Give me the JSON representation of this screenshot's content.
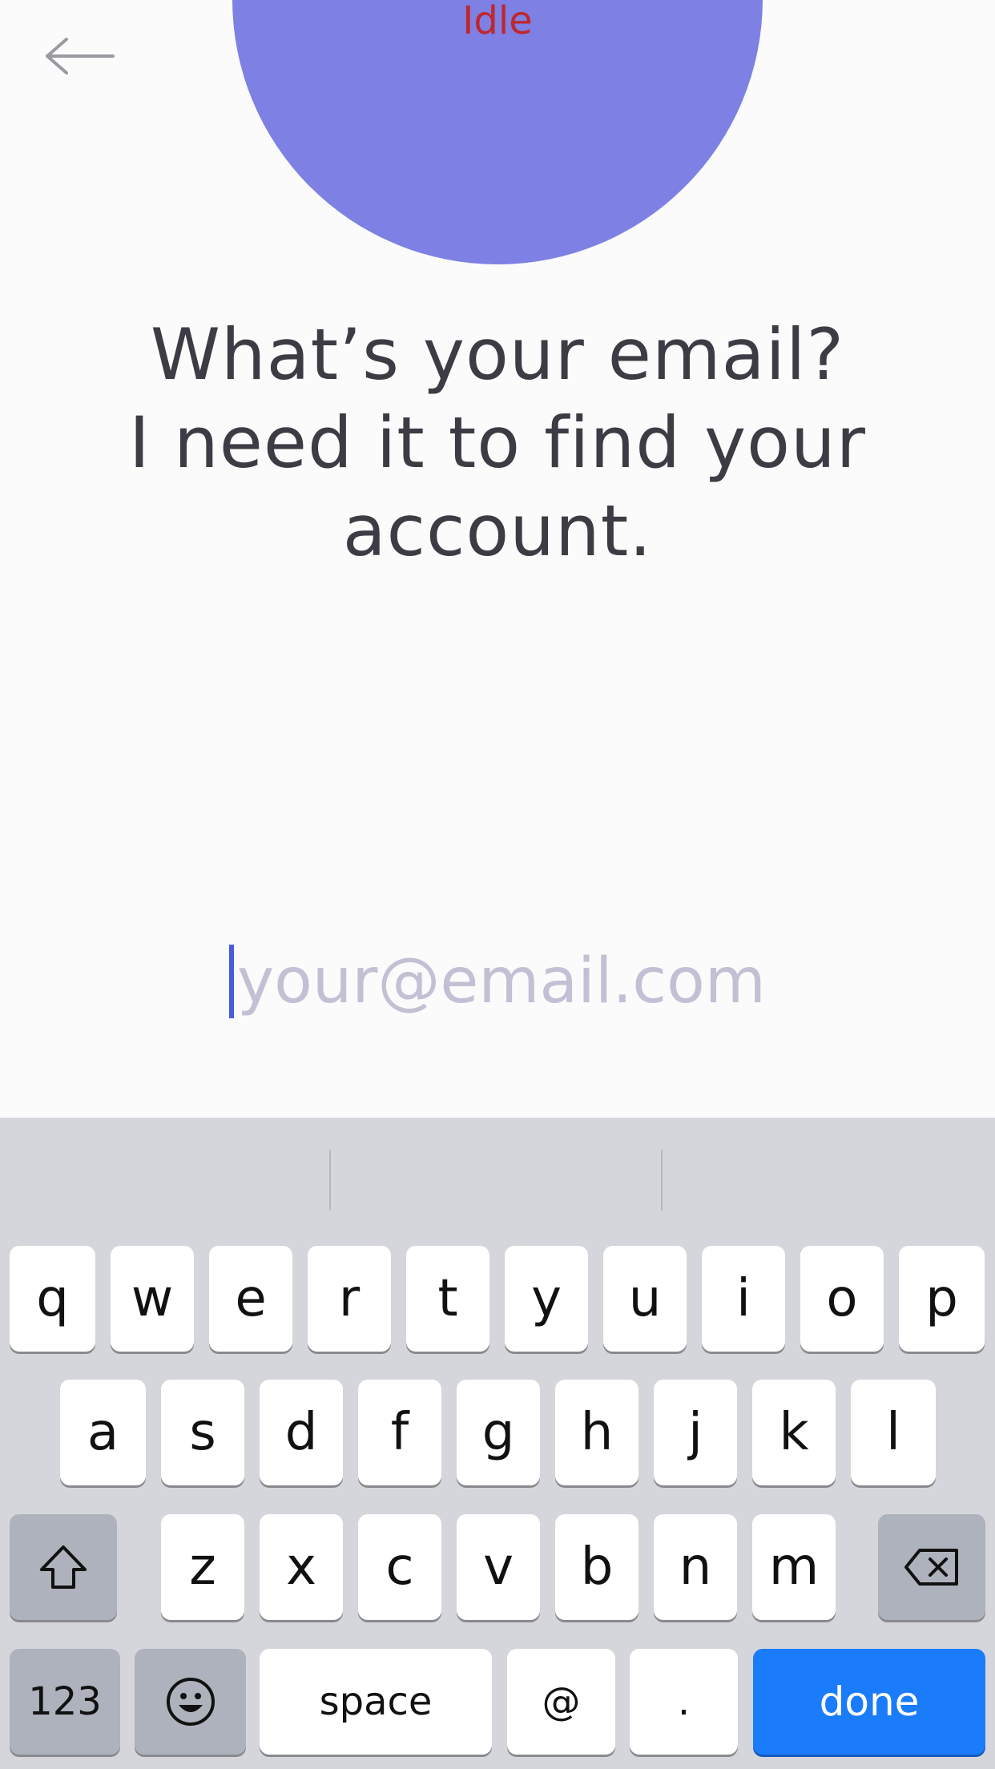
{
  "status": {
    "label": "Idle"
  },
  "headline": {
    "line1": "What’s your email?",
    "line2": "I need it to find your",
    "line3": "account."
  },
  "email": {
    "placeholder": "your@email.com",
    "value": ""
  },
  "keyboard": {
    "row1": [
      "q",
      "w",
      "e",
      "r",
      "t",
      "y",
      "u",
      "i",
      "o",
      "p"
    ],
    "row2": [
      "a",
      "s",
      "d",
      "f",
      "g",
      "h",
      "j",
      "k",
      "l"
    ],
    "row3": [
      "z",
      "x",
      "c",
      "v",
      "b",
      "n",
      "m"
    ],
    "numbers_label": "123",
    "space_label": "space",
    "at_label": "@",
    "dot_label": ".",
    "done_label": "done",
    "icons": {
      "shift": "shift-icon",
      "delete": "delete-icon",
      "emoji": "emoji-icon",
      "back": "arrow-left-icon"
    }
  },
  "colors": {
    "accent": "#7e80e3",
    "status": "#c0272d",
    "done": "#1a7bfb"
  }
}
